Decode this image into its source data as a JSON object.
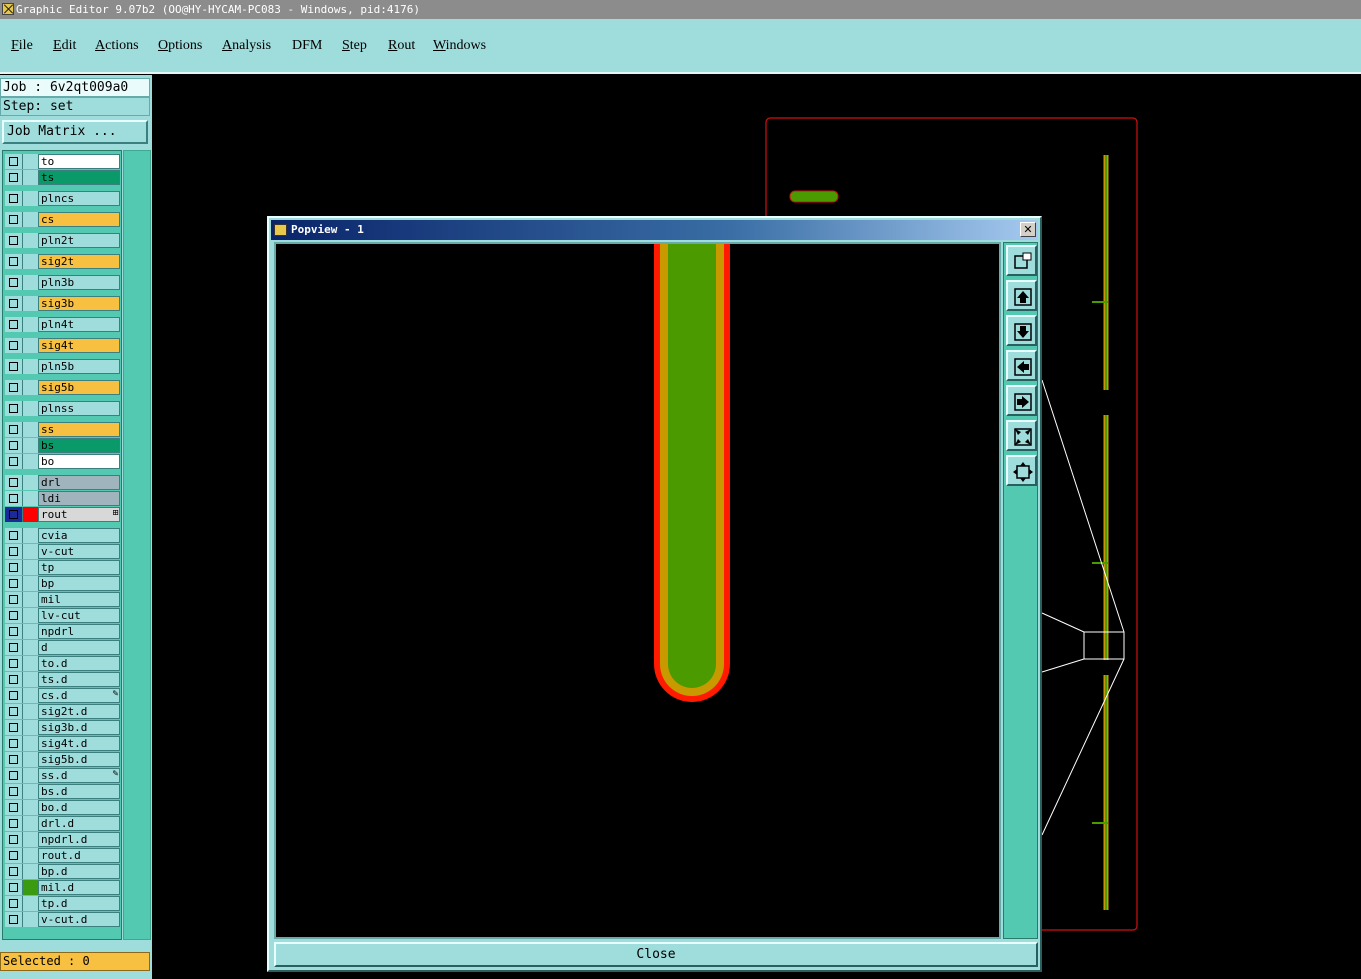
{
  "window": {
    "title": "Graphic Editor 9.07b2 (OO@HY-HYCAM-PC083 - Windows, pid:4176)"
  },
  "menu": [
    {
      "label": "File",
      "u": "F",
      "rest": "ile"
    },
    {
      "label": "Edit",
      "u": "E",
      "rest": "dit"
    },
    {
      "label": "Actions",
      "u": "A",
      "rest": "ctions"
    },
    {
      "label": "Options",
      "u": "O",
      "rest": "ptions"
    },
    {
      "label": "Analysis",
      "u": "A",
      "rest": "nalysis"
    },
    {
      "label": "DFM",
      "u": "",
      "rest": "DFM"
    },
    {
      "label": "Step",
      "u": "S",
      "rest": "tep"
    },
    {
      "label": "Rout",
      "u": "R",
      "rest": "out"
    },
    {
      "label": "Windows",
      "u": "W",
      "rest": "indows"
    }
  ],
  "left": {
    "job": "Job : 6v2qt009a0",
    "step": "Step: set",
    "job_matrix": "Job Matrix ...",
    "selected": "Selected : 0"
  },
  "layers": [
    {
      "name": "to",
      "color": "#ffffff"
    },
    {
      "name": "ts",
      "color": "#0a9a6a"
    },
    {
      "name": "plncs",
      "color": "#9fdcdc",
      "gap": true
    },
    {
      "name": "cs",
      "color": "#f8c040",
      "gap": true
    },
    {
      "name": "pln2t",
      "color": "#9fdcdc",
      "gap": true
    },
    {
      "name": "sig2t",
      "color": "#f8c040",
      "gap": true
    },
    {
      "name": "pln3b",
      "color": "#9fdcdc",
      "gap": true
    },
    {
      "name": "sig3b",
      "color": "#f8c040",
      "gap": true
    },
    {
      "name": "pln4t",
      "color": "#9fdcdc",
      "gap": true
    },
    {
      "name": "sig4t",
      "color": "#f8c040",
      "gap": true
    },
    {
      "name": "pln5b",
      "color": "#9fdcdc",
      "gap": true
    },
    {
      "name": "sig5b",
      "color": "#f8c040",
      "gap": true
    },
    {
      "name": "plnss",
      "color": "#9fdcdc",
      "gap": true
    },
    {
      "name": "ss",
      "color": "#f8c040",
      "gap": true
    },
    {
      "name": "bs",
      "color": "#0a9a6a"
    },
    {
      "name": "bo",
      "color": "#ffffff"
    },
    {
      "name": "drl",
      "color": "#9fb4bc",
      "gap": true
    },
    {
      "name": "ldi",
      "color": "#9fb4bc"
    },
    {
      "name": "rout",
      "color": "#d8d8d8",
      "active": true,
      "swatch": "#ff0000",
      "mark": "⊞"
    },
    {
      "name": "cvia",
      "color": "#9fdcdc",
      "gap": true
    },
    {
      "name": "v-cut",
      "color": "#9fdcdc"
    },
    {
      "name": "tp",
      "color": "#9fdcdc"
    },
    {
      "name": "bp",
      "color": "#9fdcdc"
    },
    {
      "name": "mil",
      "color": "#9fdcdc"
    },
    {
      "name": "lv-cut",
      "color": "#9fdcdc"
    },
    {
      "name": "npdrl",
      "color": "#9fdcdc"
    },
    {
      "name": "d",
      "color": "#9fdcdc"
    },
    {
      "name": "to.d",
      "color": "#9fdcdc"
    },
    {
      "name": "ts.d",
      "color": "#9fdcdc"
    },
    {
      "name": "cs.d",
      "color": "#9fdcdc",
      "mark": "✎"
    },
    {
      "name": "sig2t.d",
      "color": "#9fdcdc"
    },
    {
      "name": "sig3b.d",
      "color": "#9fdcdc"
    },
    {
      "name": "sig4t.d",
      "color": "#9fdcdc"
    },
    {
      "name": "sig5b.d",
      "color": "#9fdcdc"
    },
    {
      "name": "ss.d",
      "color": "#9fdcdc",
      "mark": "✎"
    },
    {
      "name": "bs.d",
      "color": "#9fdcdc"
    },
    {
      "name": "bo.d",
      "color": "#9fdcdc"
    },
    {
      "name": "drl.d",
      "color": "#9fdcdc"
    },
    {
      "name": "npdrl.d",
      "color": "#9fdcdc"
    },
    {
      "name": "rout.d",
      "color": "#9fdcdc"
    },
    {
      "name": "bp.d",
      "color": "#9fdcdc"
    },
    {
      "name": "mil.d",
      "color": "#9fdcdc",
      "swatch": "#3a9a10"
    },
    {
      "name": "tp.d",
      "color": "#9fdcdc"
    },
    {
      "name": "v-cut.d",
      "color": "#9fdcdc"
    }
  ],
  "popview": {
    "title": "Popview - 1",
    "close_x": "✕",
    "close_label": "Close",
    "tools": [
      "zoom-window-icon",
      "pan-up-icon",
      "pan-down-icon",
      "pan-left-icon",
      "pan-right-icon",
      "zoom-in-icon",
      "zoom-out-icon"
    ]
  },
  "colors": {
    "background": "#9fdcdc",
    "panel": "#52c9b0",
    "signal": "#f8c040",
    "mask": "#0a9a6a",
    "rout": "#ff0000",
    "feature_fill": "#4a9a00",
    "feature_ring": "#c89a00"
  }
}
